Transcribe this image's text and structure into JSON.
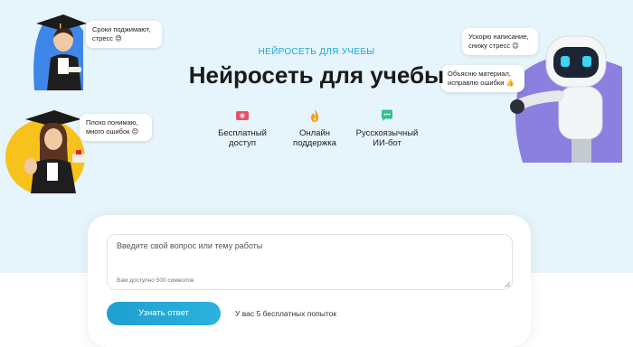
{
  "hero": {
    "eyebrow": "НЕЙРОСЕТЬ ДЛЯ УЧЕБЫ",
    "title": "Нейросеть для учебы"
  },
  "features": [
    {
      "icon": "money-icon",
      "label_line1": "Бесплатный",
      "label_line2": "доступ"
    },
    {
      "icon": "flame-icon",
      "label_line1": "Онлайн",
      "label_line2": "поддержка"
    },
    {
      "icon": "chat-icon",
      "label_line1": "Русскоязычный",
      "label_line2": "ИИ-бот"
    }
  ],
  "bubbles": {
    "top_left_line1": "Сроки поджимают,",
    "top_left_line2": "стресс 😓",
    "mid_left_line1": "Плохо понимаю,",
    "mid_left_line2": "много ошибок 😔",
    "robot_top_line1": "Ускорю написание,",
    "robot_top_line2": "снижу стресс 😊",
    "robot_mid_line1": "Объясню материал,",
    "robot_mid_line2": "исправлю ошибки 👍"
  },
  "form": {
    "placeholder": "Введите свой вопрос или тему работы",
    "hint": "Вам доступно 500 символов",
    "submit_label": "Узнать ответ",
    "attempts": "У вас 5 бесплатных попыток"
  },
  "colors": {
    "accent": "#1ba7d4",
    "hero_bg": "#e6f4fb"
  }
}
